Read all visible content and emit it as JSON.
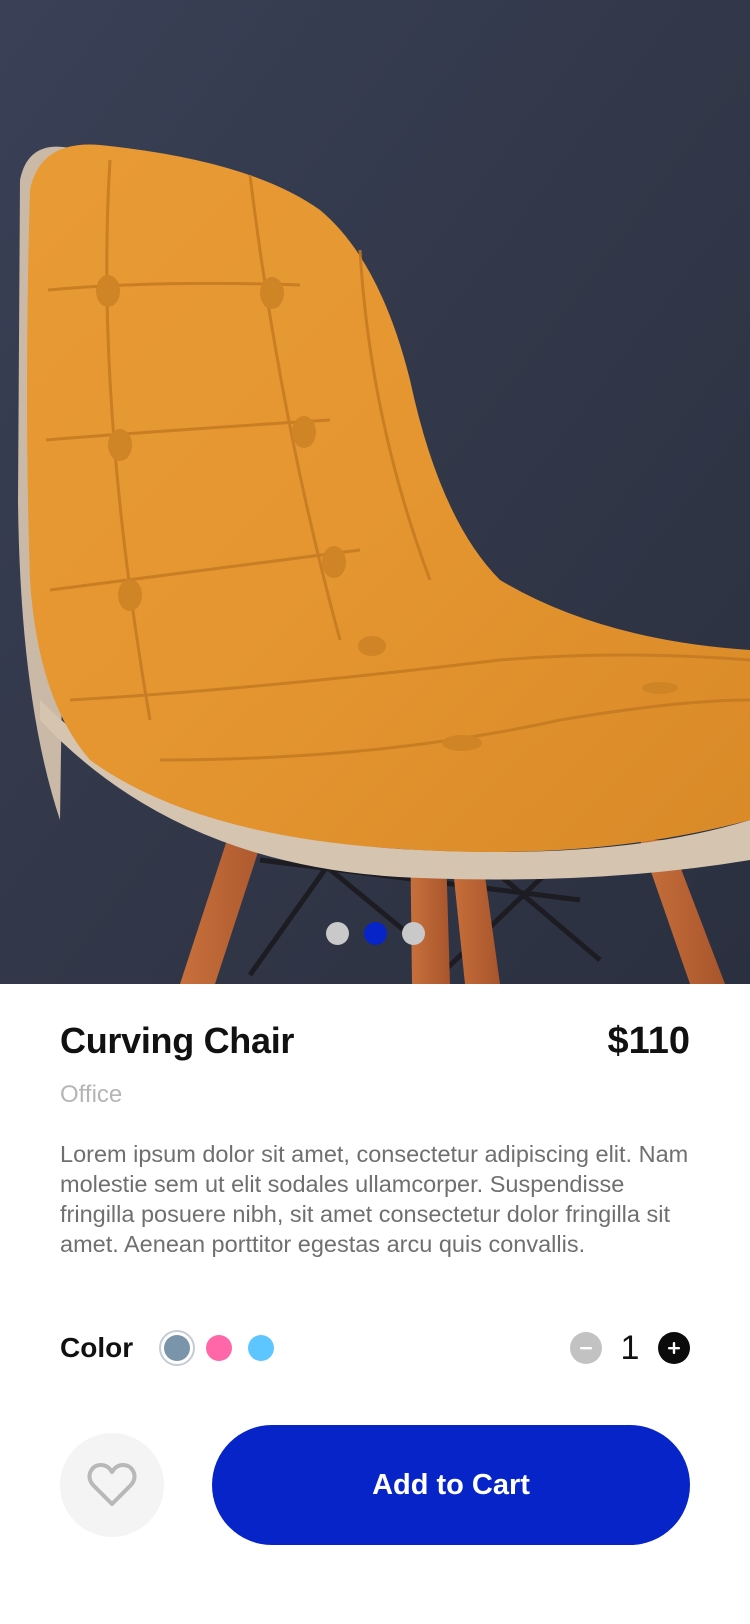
{
  "product": {
    "name": "Curving Chair",
    "price": "$110",
    "category": "Office",
    "description": "Lorem ipsum dolor sit amet, consectetur adipiscing elit. Nam molestie sem ut elit sodales ullamcorper. Suspendisse fringilla posuere nibh, sit amet consectetur dolor fringilla sit amet. Aenean porttitor egestas arcu quis convallis."
  },
  "gallery": {
    "image_count": 3,
    "active_index": 1
  },
  "options": {
    "color_label": "Color",
    "colors": [
      "#7a94aa",
      "#ff67a9",
      "#5ec6ff"
    ],
    "selected_color_index": 0,
    "quantity": "1",
    "minus_icon": "minus-icon",
    "plus_icon": "plus-icon"
  },
  "actions": {
    "favorite_icon": "heart-icon",
    "add_to_cart_label": "Add to Cart"
  },
  "colors": {
    "accent": "#0624c8",
    "chair": "#e9982f",
    "background_wall": "#343a4e"
  }
}
